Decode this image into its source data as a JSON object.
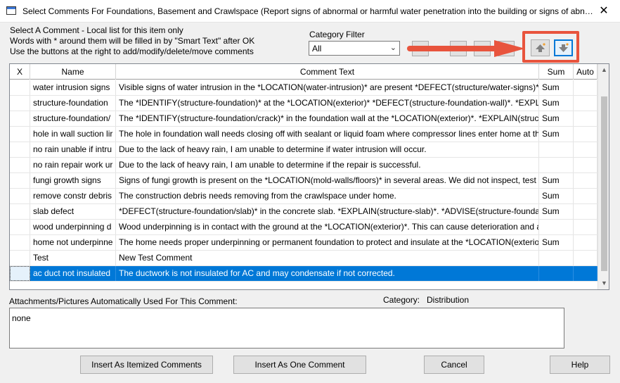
{
  "window": {
    "title": "Select Comments For Foundations, Basement and Crawlspace (Report signs of abnormal or harmful water penetration into the building or signs of abnor...",
    "close_symbol": "✕"
  },
  "instructions": [
    "Select A Comment - Local list for this item only",
    "Words with * around them will be filled in by \"Smart Text\" after OK",
    "Use the buttons at the right to add/modify/delete/move comments"
  ],
  "category_filter": {
    "label": "Category Filter",
    "value": "All",
    "arrow": "⌄"
  },
  "toolbar": {
    "move_up_symbol": "🡅",
    "move_down_symbol": "🡇"
  },
  "annotation": {
    "arrow_color": "#e8543d",
    "box_color": "#e8543d"
  },
  "grid": {
    "columns": [
      "X",
      "Name",
      "Comment Text",
      "Sum",
      "Auto"
    ],
    "rows": [
      {
        "x": "",
        "name": "water intrusion signs",
        "text": "Visible signs of water intrusion in the *LOCATION(water-intrusion)* are present *DEFECT(structure/water-signs)*. *",
        "sum": "Sum",
        "auto": ""
      },
      {
        "x": "",
        "name": "structure-foundation",
        "text": "The *IDENTIFY(structure-foundation)* at the *LOCATION(exterior)* *DEFECT(structure-foundation-wall)*. *EXPLAI",
        "sum": "Sum",
        "auto": ""
      },
      {
        "x": "",
        "name": "structure-foundation/",
        "text": "The *IDENTIFY(structure-foundation/crack)* in the foundation wall at the *LOCATION(exterior)*. *EXPLAIN(structu",
        "sum": "Sum",
        "auto": ""
      },
      {
        "x": "",
        "name": "hole in wall suction lir",
        "text": "The hole in foundation wall needs closing off with sealant or liquid foam where compressor lines enter home at th",
        "sum": "Sum",
        "auto": ""
      },
      {
        "x": "",
        "name": "no rain unable if intru",
        "text": "Due to the lack of heavy rain, I am unable to determine if water intrusion will occur.",
        "sum": "",
        "auto": ""
      },
      {
        "x": "",
        "name": "no rain repair work ur",
        "text": "Due to the lack of heavy rain, I am unable to determine if the repair is successful.",
        "sum": "",
        "auto": ""
      },
      {
        "x": "",
        "name": "fungi growth signs",
        "text": "Signs of fungi growth is present on the *LOCATION(mold-walls/floors)* in several areas. We did not inspect, test c",
        "sum": "Sum",
        "auto": ""
      },
      {
        "x": "",
        "name": "remove constr debris",
        "text": "The construction debris needs removing from the crawlspace under home.",
        "sum": "Sum",
        "auto": ""
      },
      {
        "x": "",
        "name": "slab defect",
        "text": "*DEFECT(structure-foundation/slab)* in the concrete slab. *EXPLAIN(structure-slab)*. *ADVISE(structure-foundati",
        "sum": "Sum",
        "auto": ""
      },
      {
        "x": "",
        "name": "wood underpinning d",
        "text": "Wood underpinning is in contact with the ground at the *LOCATION(exterior)*. This can cause deterioration and a",
        "sum": "",
        "auto": ""
      },
      {
        "x": "",
        "name": "home not underpinne",
        "text": "The home needs proper underpinning or permanent foundation to protect and insulate at the *LOCATION(exterio",
        "sum": "Sum",
        "auto": ""
      },
      {
        "x": "",
        "name": "Test",
        "text": "New Test Comment",
        "sum": "",
        "auto": ""
      },
      {
        "x": "",
        "name": "ac duct not insulated",
        "text": "The ductwork is not insulated for AC and may condensate if not corrected.",
        "sum": "",
        "auto": "",
        "selected": true
      }
    ],
    "selected_color": "#0078d7"
  },
  "attachments": {
    "label": "Attachments/Pictures Automatically Used For This Comment:",
    "value": "none"
  },
  "category": {
    "label": "Category:",
    "value": "Distribution"
  },
  "buttons": {
    "insert_itemized": "Insert As Itemized Comments",
    "insert_one": "Insert As One Comment",
    "cancel": "Cancel",
    "help": "Help"
  }
}
